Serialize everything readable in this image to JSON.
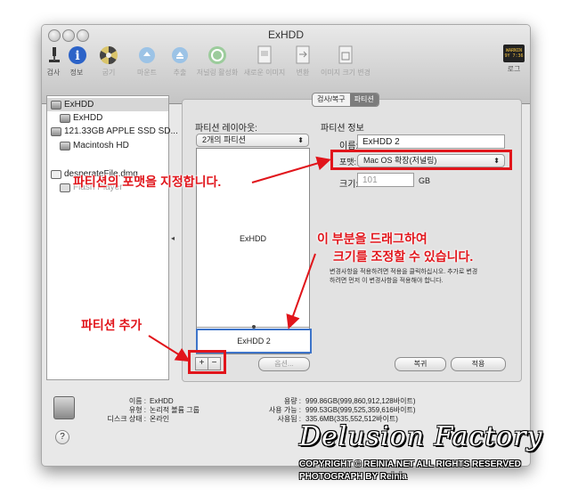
{
  "window": {
    "title": "ExHDD"
  },
  "toolbar": {
    "items": [
      {
        "label": "검사",
        "icon": "microscope-icon"
      },
      {
        "label": "정보",
        "icon": "info-icon"
      },
      {
        "label": "굽기",
        "icon": "burn-icon"
      },
      {
        "label": "마운트",
        "icon": "mount-icon"
      },
      {
        "label": "추출",
        "icon": "eject-icon"
      },
      {
        "label": "저널링 활성화",
        "icon": "journal-icon"
      },
      {
        "label": "새로운 이미지",
        "icon": "new-image-icon"
      },
      {
        "label": "변환",
        "icon": "convert-icon"
      },
      {
        "label": "이미지 크기 변경",
        "icon": "resize-image-icon"
      },
      {
        "label": "로그",
        "icon": "log-icon"
      }
    ],
    "log_badge": "WARNIN\n9Y 7:36"
  },
  "sidebar": {
    "items": [
      {
        "label": "ExHDD"
      },
      {
        "label": "ExHDD"
      },
      {
        "label": "121.33GB APPLE SSD SD..."
      },
      {
        "label": "Macintosh HD"
      },
      {
        "label": "desperateFile.dmg"
      },
      {
        "label": "Flash Player"
      }
    ]
  },
  "tabs": [
    "검사/복구",
    "파티션"
  ],
  "partition": {
    "layout_label": "파티션 레이아웃:",
    "layout_select": "2개의 파티션",
    "info_label": "파티션 정보",
    "name_label": "이름:",
    "name_value": "ExHDD 2",
    "format_label": "포맷:",
    "format_value": "Mac OS 확장(저널링)",
    "size_label": "크기:",
    "size_value": "101",
    "size_unit": "GB",
    "part1_name": "ExHDD",
    "part2_name": "ExHDD 2",
    "add_button": "+",
    "remove_button": "−",
    "options_button": "옵션...",
    "revert_button": "복귀",
    "apply_button": "적용",
    "note": "변경사항을 적용하려면 적용을 클릭하십시오. 추가로 변경하려면 먼저 이 변경사항을 적용해야 합니다."
  },
  "info": {
    "name_label": "이름 :",
    "name_value": "ExHDD",
    "type_label": "유형 :",
    "type_value": "논리적 볼륨 그룹",
    "status_label": "디스크 상태 :",
    "status_value": "온라인",
    "capacity_label": "용량 :",
    "capacity_value": "999.86GB(999,860,912,128바이트)",
    "available_label": "사용 가능 :",
    "available_value": "999.53GB(999,525,359,616바이트)",
    "used_label": "사용됨 :",
    "used_value": "335.6MB(335,552,512바이트)"
  },
  "help_button": "?",
  "annotations": {
    "format": "파티션의 포맷을 지정합니다.",
    "drag_line1": "이 부분을 드래그하여",
    "drag_line2": "크기를 조정할 수 있습니다.",
    "add": "파티션 추가"
  },
  "watermark": {
    "brand": "Delusion Factory",
    "copyright": "COPYRIGHT © REINIA.NET ALL RIGHTS RESERVED",
    "photo": "PHOTOGRAPH BY Reinia"
  },
  "colors": {
    "annotation_red": "#e1151b",
    "selection_blue": "#3d74c9"
  }
}
